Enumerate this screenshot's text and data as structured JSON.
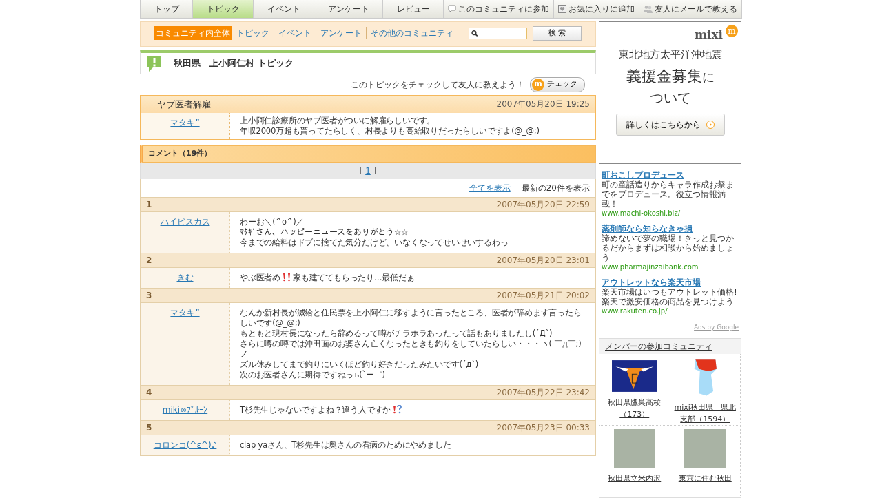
{
  "nav_tabs": [
    {
      "label": "トップ",
      "selected": false
    },
    {
      "label": "トピック",
      "selected": true
    },
    {
      "label": "イベント",
      "selected": false
    },
    {
      "label": "アンケート",
      "selected": false
    },
    {
      "label": "レビュー",
      "selected": false
    },
    {
      "label": "このコミュニティに参加",
      "selected": false
    },
    {
      "label": "お気に入りに追加",
      "selected": false
    },
    {
      "label": "友人にメールで教える",
      "selected": false
    }
  ],
  "search": {
    "scopes": [
      {
        "label": "コミュニティ内全体",
        "selected": true
      },
      {
        "label": "トピック",
        "selected": false
      },
      {
        "label": "イベント",
        "selected": false
      },
      {
        "label": "アンケート",
        "selected": false
      },
      {
        "label": "その他のコミュニティ",
        "selected": false
      }
    ],
    "button": "検 索"
  },
  "page_title": "秋田県　上小阿仁村 トピック",
  "check": {
    "text": "このトピックをチェックして友人に教えよう！",
    "button_mark": "m",
    "button": "チェック"
  },
  "topic": {
    "title": "ヤブ医者解雇",
    "date": "2007年05月20日  19:25",
    "author": "マタキ”",
    "lines": [
      "上小阿仁診療所のヤブ医者がついに解雇らしいです。",
      "年収2000万超も貰ってたらしく、村長よりも高給取りだったらしいですよ(@_@;)"
    ]
  },
  "comments_header": "コメント（19件）",
  "pager": {
    "open": "[",
    "page": "1",
    "close": "]"
  },
  "show_all": "全てを表示",
  "latest": "最新の20件を表示",
  "comments": [
    {
      "number": "1",
      "date": "2007年05月20日  22:59",
      "author": "ハイビスカス",
      "lines": [
        [
          {
            "kind": "text",
            "text": "わーお＼(^o^)／"
          }
        ],
        [
          {
            "kind": "text",
            "text": "ﾏﾀｷﾞさん、ハッピーニュースをありがとう☆☆"
          }
        ],
        [
          {
            "kind": "text",
            "text": "今までの給料はドブに捨てた気分だけど、いなくなってせいせいするわっ"
          }
        ]
      ]
    },
    {
      "number": "2",
      "date": "2007年05月20日  23:01",
      "author": "きむ",
      "lines": [
        [
          {
            "kind": "text",
            "text": "やぶ医者め"
          },
          {
            "kind": "exclaim"
          },
          {
            "kind": "text",
            "text": "家も建ててもらったり…最低だぁ"
          }
        ]
      ]
    },
    {
      "number": "3",
      "date": "2007年05月21日  20:02",
      "author": "マタキ”",
      "lines": [
        [
          {
            "kind": "text",
            "text": "なんか新村長が減給と住民票を上小阿仁に移すように言ったところ、医者が辞めます言ったらしいです(@_@;)"
          }
        ],
        [
          {
            "kind": "text",
            "text": "もともと現村長になったら辞めるって噂がチラホラあったって話もありましたし(´Д`)"
          }
        ],
        [
          {
            "kind": "text",
            "text": "さらに噂の噂では沖田面のお婆さん亡くなったときも釣りをしていたらしい・・・ヽ( ￣д￣;)ノ"
          }
        ],
        [
          {
            "kind": "text",
            "text": "ズル休みしてまで釣りにいくほど釣り好きだったみたいです(´д`)"
          }
        ],
        [
          {
            "kind": "text",
            "text": "次のお医者さんに期待ですねっъ(`ー゜)"
          }
        ]
      ]
    },
    {
      "number": "4",
      "date": "2007年05月22日  23:42",
      "author": "miki∞ﾌﾟﾙｰﾝ",
      "lines": [
        [
          {
            "kind": "text",
            "text": "T杉先生じゃないですよね？違う人ですか"
          },
          {
            "kind": "question"
          }
        ]
      ]
    },
    {
      "number": "5",
      "date": "2007年05月23日  00:33",
      "author": "コロンコ(^ε^)♪",
      "lines": [
        [
          {
            "kind": "text",
            "text": "clap yaさん、T杉先生は奥さんの看病のためにやめました"
          }
        ]
      ]
    }
  ],
  "banner": {
    "logo": "mixi",
    "logo_mark": "m",
    "line1": "東北地方太平洋沖地震",
    "line2": "義援金募集",
    "line2_small": "に",
    "line3": "ついて",
    "button": "詳しくはこちらから"
  },
  "ads": [
    {
      "title": "町おこしプロデュース",
      "text": "町の童話造りからキャラ作成お祭までをプロデュース。役立つ情報満載！",
      "url": "www.machi-okoshi.biz/"
    },
    {
      "title": "薬剤師なら知らなきゃ損",
      "text": "諦めないで夢の職場！きっと見つかるだからまずは相談から始めましょう",
      "url": "www.pharmajinzaibank.com"
    },
    {
      "title": "アウトレットなら楽天市場",
      "text": "楽天市場はいつもアウトレット価格!楽天で激安価格の商品を見つけよう",
      "url": "www.rakuten.co.jp/"
    }
  ],
  "ads_by": "Ads by Google",
  "member_communities": {
    "title": "メンバーの参加コミュニティ",
    "items": [
      {
        "name": "秋田県鷹巣高校（173）",
        "kind": "emblem"
      },
      {
        "name": "mixi秋田県　県北支部（1594）",
        "kind": "map"
      },
      {
        "name": "秋田県立米内沢",
        "kind": "photo"
      },
      {
        "name": "東京に住む秋田",
        "kind": "photo"
      }
    ]
  }
}
